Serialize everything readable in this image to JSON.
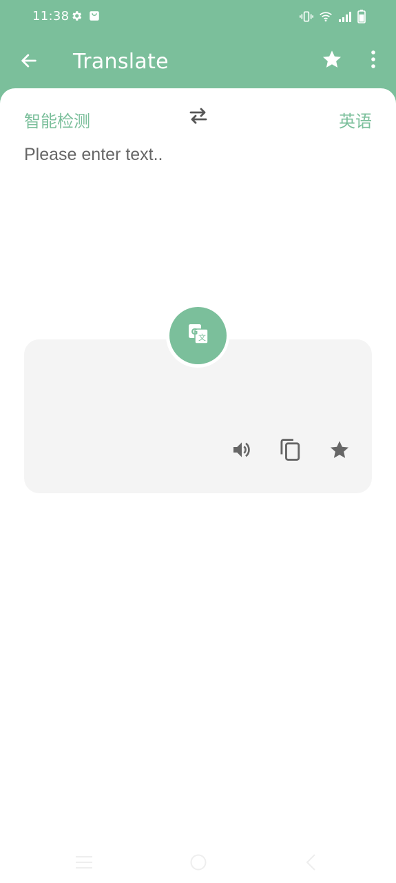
{
  "status_bar": {
    "time": "11:38",
    "left_icons": [
      "gear-icon",
      "shopping-bag-icon"
    ],
    "right_icons": [
      "vibrate-icon",
      "wifi-icon",
      "signal-icon",
      "battery-icon"
    ]
  },
  "app_bar": {
    "title": "Translate",
    "back_icon": "arrow-left-icon",
    "favorite_icon": "star-icon",
    "menu_icon": "more-vertical-icon"
  },
  "languages": {
    "source": "智能检测",
    "target": "英语",
    "swap_icon": "swap-horizontal-icon"
  },
  "input": {
    "value": "",
    "placeholder": "Please enter text.."
  },
  "result": {
    "text": "",
    "translate_icon": "translate-icon",
    "actions": [
      "speaker-icon",
      "copy-icon",
      "star-icon"
    ]
  },
  "nav_bar": {
    "buttons": [
      "menu-icon",
      "home-icon",
      "back-icon"
    ]
  },
  "colors": {
    "primary": "#7bbf9b",
    "background": "#ffffff",
    "card": "#f4f4f4",
    "icon_gray": "#666666"
  }
}
